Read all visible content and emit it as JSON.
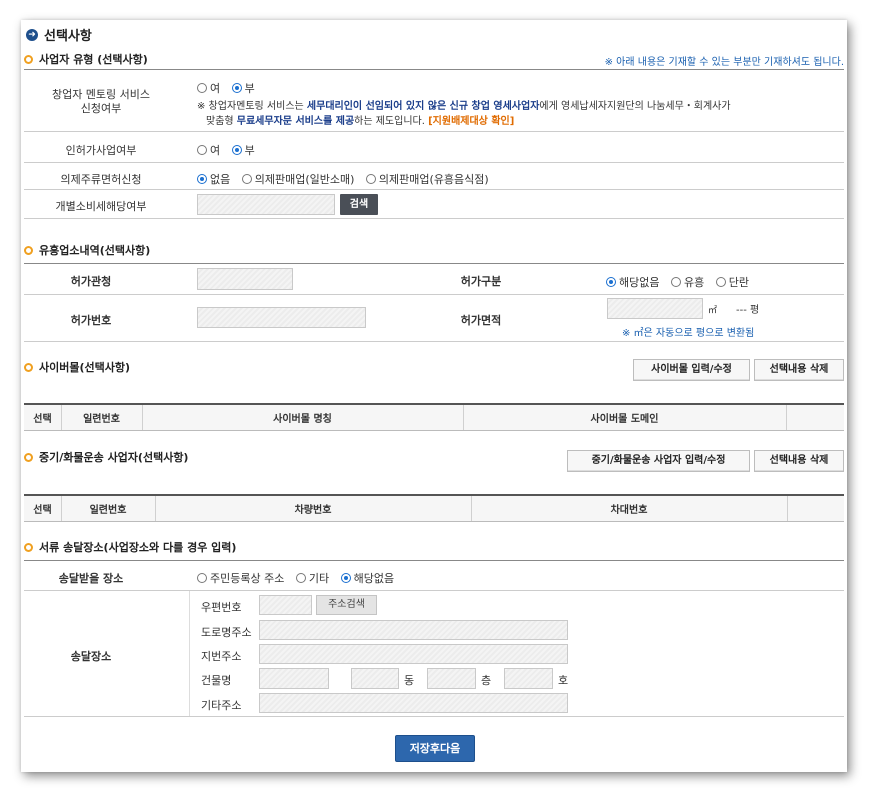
{
  "title": "선택사항",
  "section_business": {
    "title": "사업자 유형 (선택사항)",
    "notice": "※ 아래 내용은 기재할 수 있는 부분만 기재하셔도 됩니다.",
    "mentoring": {
      "label_line1": "창업자 멘토링 서비스",
      "label_line2": "신청여부",
      "options": [
        "여",
        "부"
      ],
      "note_prefix": "※ 창업자멘토링 서비스는 ",
      "note_bold1": "세무대리인이 선임되어 있지 않은 신규 창업 영세사업자",
      "note_mid": "에게 영세납세자지원단의 나눔세무・회계사가",
      "note_line2_prefix": "맞춤형 ",
      "note_bold2": "무료세무자문 서비스를 제공",
      "note_line2_mid": "하는 제도입니다. ",
      "note_link": "[지원배제대상 확인]"
    },
    "permit": {
      "label": "인허가사업여부",
      "options": [
        "여",
        "부"
      ]
    },
    "liquor": {
      "label": "의제주류면허신청",
      "options": [
        "없음",
        "의제판매업(일반소매)",
        "의제판매업(유흥음식점)"
      ]
    },
    "excise": {
      "label": "개별소비세해당여부",
      "search_button": "검색"
    }
  },
  "section_entertainment": {
    "title": "유흥업소내역(선택사항)",
    "authority_label": "허가관청",
    "type_label": "허가구분",
    "type_options": [
      "해당없음",
      "유흥",
      "단란"
    ],
    "number_label": "허가번호",
    "area_label": "허가면적",
    "area_unit": "㎡",
    "pyeong_value": "---",
    "pyeong_unit": "평",
    "area_note": "※ ㎡은 자동으로 평으로 변환됨"
  },
  "section_cybermall": {
    "title": "사이버몰(선택사항)",
    "btn_edit": "사이버몰 입력/수정",
    "btn_delete": "선택내용 삭제",
    "columns": [
      "선택",
      "일련번호",
      "사이버몰 명칭",
      "사이버몰 도메인"
    ]
  },
  "section_truck": {
    "title": "중기/화물운송 사업자(선택사항)",
    "btn_edit": "중기/화물운송 사업자 입력/수정",
    "btn_delete": "선택내용 삭제",
    "columns": [
      "선택",
      "일련번호",
      "차량번호",
      "차대번호"
    ]
  },
  "section_delivery": {
    "title": "서류 송달장소(사업장소와 다를 경우 입력)",
    "place_label": "송달받을 장소",
    "place_options": [
      "주민등록상 주소",
      "기타",
      "해당없음"
    ],
    "addr_label": "송달장소",
    "postal_label": "우편번호",
    "addr_search": "주소검색",
    "road_label": "도로명주소",
    "lot_label": "지번주소",
    "building_label": "건물명",
    "dong": "동",
    "floor": "층",
    "ho": "호",
    "etc_label": "기타주소"
  },
  "save_next": "저장후다음"
}
